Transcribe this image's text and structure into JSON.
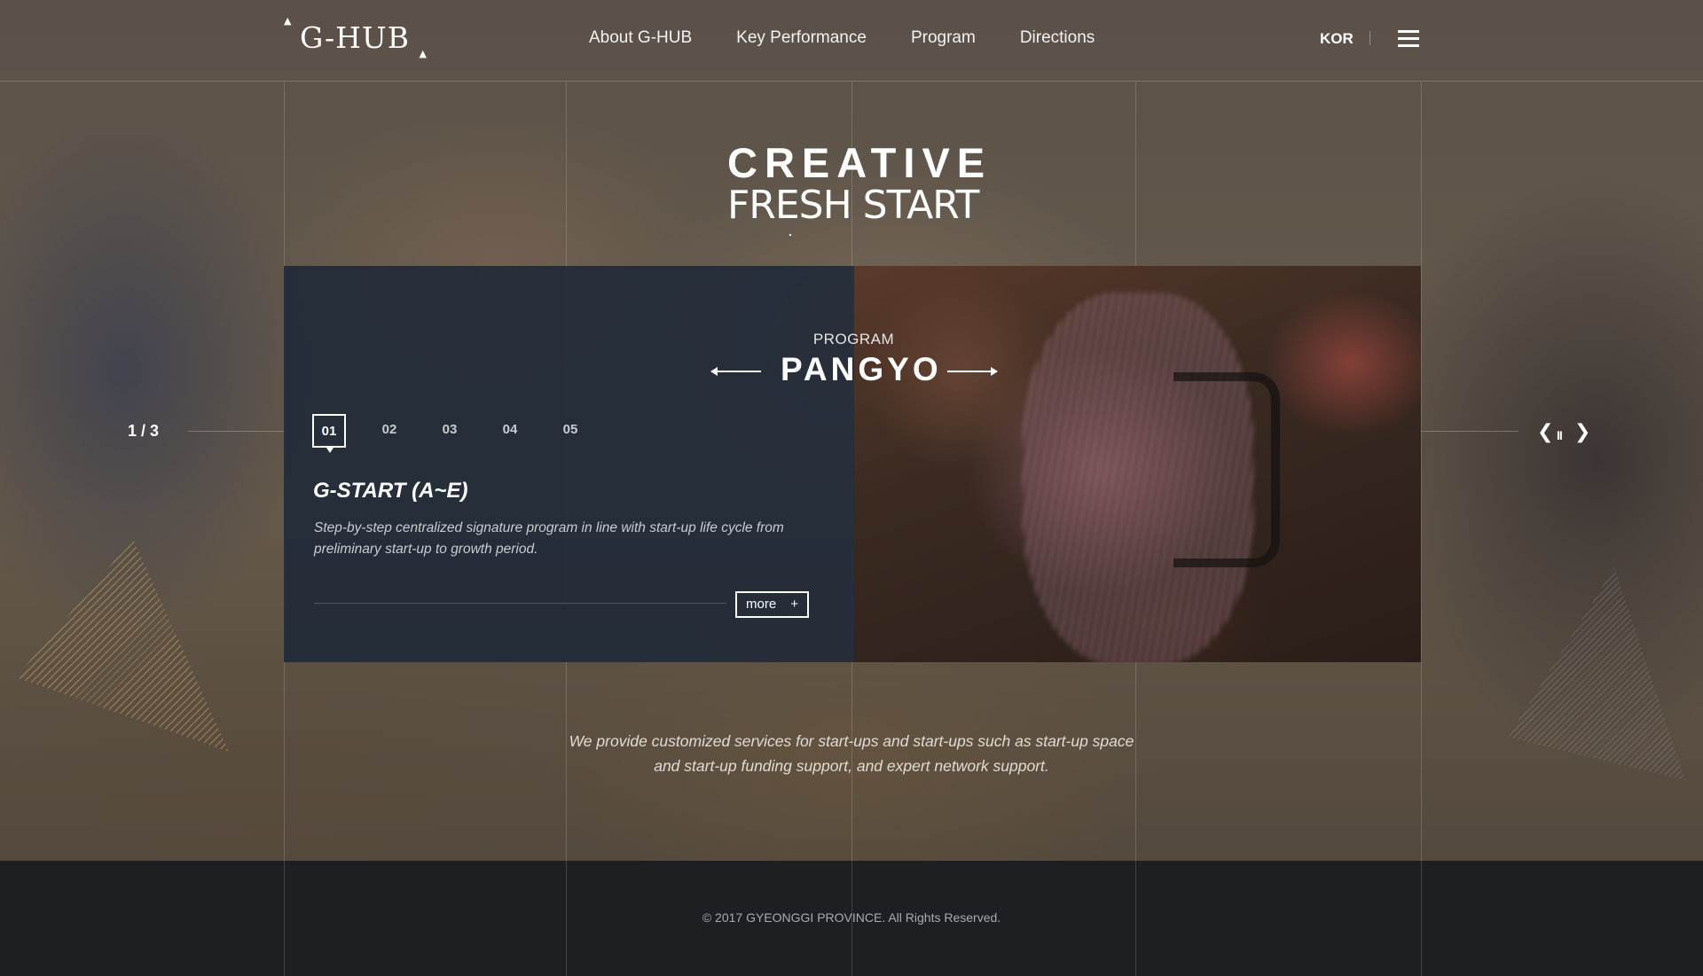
{
  "header": {
    "logo": "G-HUB",
    "nav": [
      "About G-HUB",
      "Key Performance",
      "Program",
      "Directions"
    ],
    "lang": "KOR"
  },
  "hero": {
    "title_line1": "CREATIVE",
    "title_line2": "FRESH START",
    "slide_counter": "1 / 3",
    "intro_line1": "We provide customized services for start-ups and start-ups such as start-up space",
    "intro_line2": "and start-up funding support, and expert network support."
  },
  "program": {
    "label": "PROGRAM",
    "location": "PANGYO",
    "tabs": [
      "01",
      "02",
      "03",
      "04",
      "05"
    ],
    "active_tab": 0,
    "item_title": "G-START (A~E)",
    "item_desc_line1": "Step-by-step centralized signature program in line with start-up life cycle from",
    "item_desc_line2": "preliminary start-up to growth period.",
    "more_label": "more",
    "more_icon": "+"
  },
  "controls": {
    "prev_icon": "chevron-left-icon",
    "pause_icon": "pause-icon",
    "next_icon": "chevron-right-icon"
  },
  "footer": {
    "copyright": "© 2017 GYEONGGI PROVINCE. All Rights Reserved."
  },
  "colors": {
    "card_bg": "#1e2838",
    "footer_bg": "#1d1f23",
    "accent_hatch": "#deac5c"
  }
}
